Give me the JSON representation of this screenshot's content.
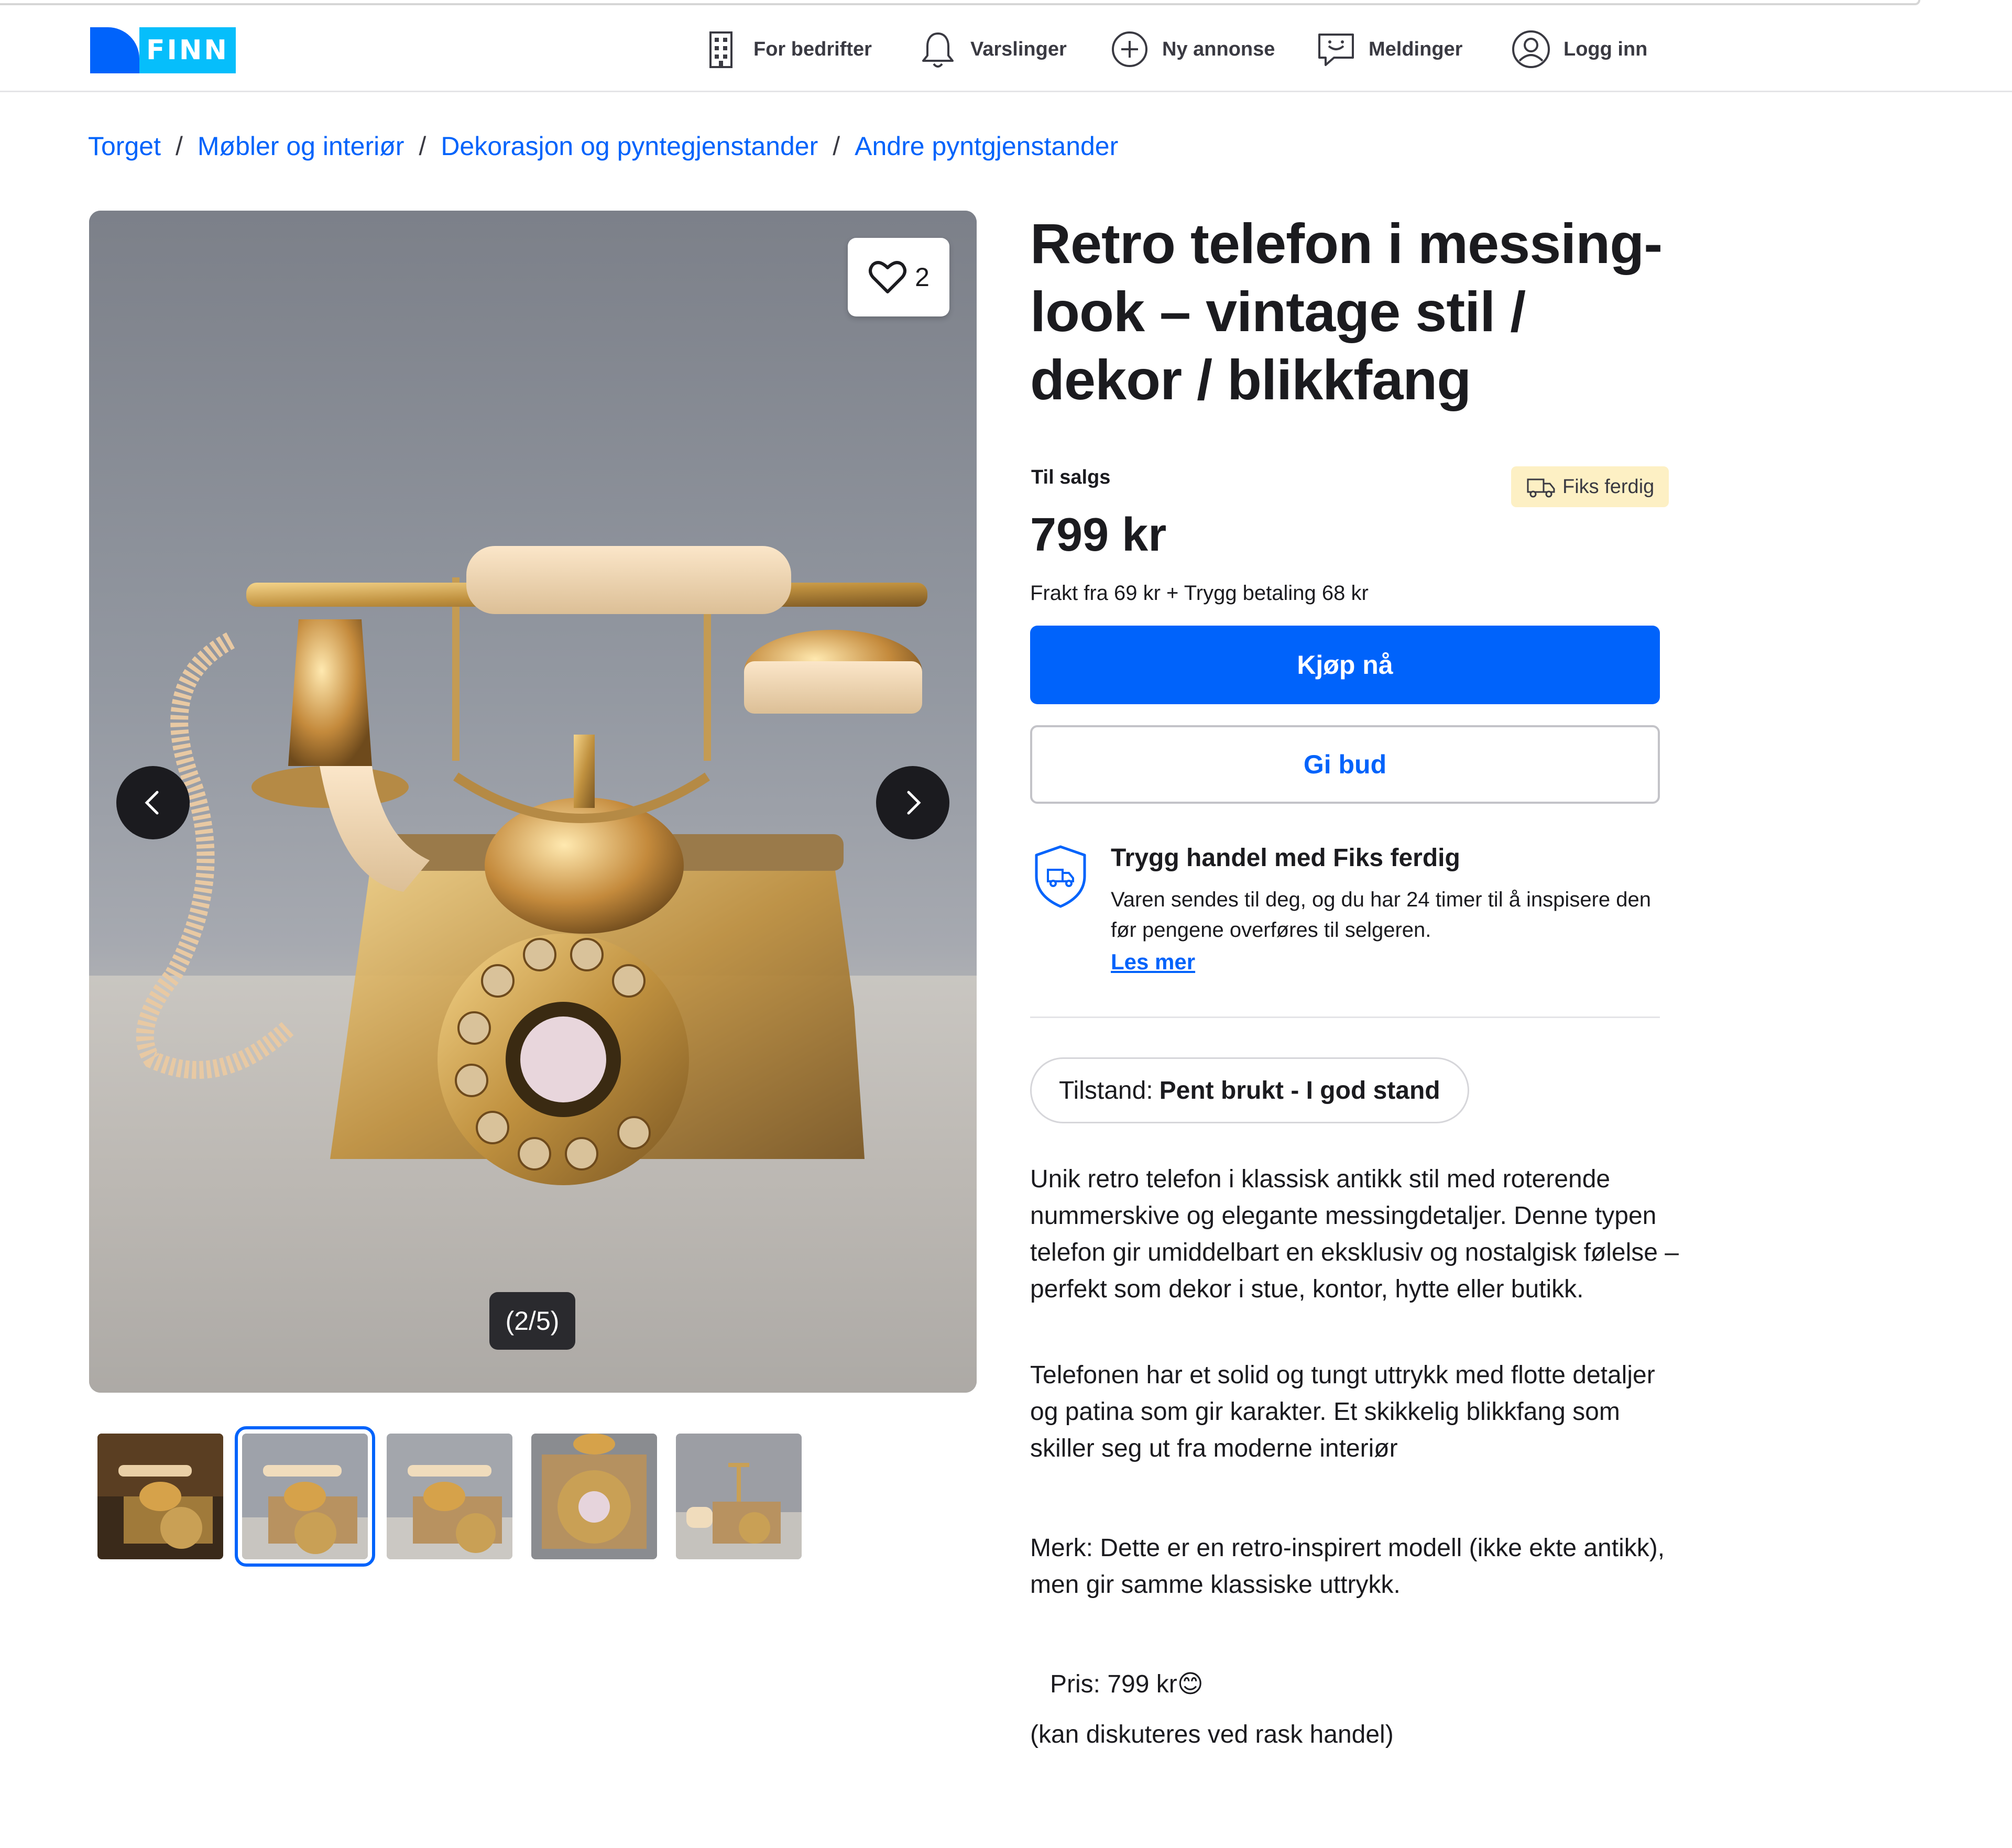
{
  "header": {
    "logo_text": "FINN",
    "nav": [
      {
        "label": "For bedrifter",
        "icon": "building-icon"
      },
      {
        "label": "Varslinger",
        "icon": "bell-icon"
      },
      {
        "label": "Ny annonse",
        "icon": "plus-circle-icon"
      },
      {
        "label": "Meldinger",
        "icon": "chat-icon"
      },
      {
        "label": "Logg inn",
        "icon": "user-circle-icon"
      }
    ]
  },
  "breadcrumb": [
    "Torget",
    "Møbler og interiør",
    "Dekorasjon og pyntegjenstander",
    "Andre pyntgjenstander"
  ],
  "gallery": {
    "favorites_count": "2",
    "counter": "(2/5)",
    "thumbnail_count": 5,
    "selected_thumbnail": 2
  },
  "listing": {
    "title": "Retro telefon i messing-look – vintage stil / dekor / blikkfang",
    "status": "Til salgs",
    "fiks_badge": "Fiks ferdig",
    "price": "799 kr",
    "shipping": "Frakt fra 69 kr + Trygg betaling 68 kr",
    "buy_label": "Kjøp nå",
    "bid_label": "Gi bud",
    "safe_title": "Trygg handel med Fiks ferdig",
    "safe_text": "Varen sendes til deg, og du har 24 timer til å inspisere den før pengene overføres til selgeren.",
    "safe_link": "Les mer",
    "condition_label": "Tilstand:",
    "condition_value": "Pent brukt - I god stand",
    "description": [
      "Unik retro telefon i klassisk antikk stil med roterende nummerskive og elegante messingdetaljer. Denne typen telefon gir umiddelbart en eksklusiv og nostalgisk følelse – perfekt som dekor i stue, kontor, hytte eller butikk.",
      "Telefonen har et solid og tungt uttrykk med flotte detaljer og patina som gir karakter. Et skikkelig blikkfang som skiller seg ut fra moderne interiør",
      "Merk: Dette er en retro-inspirert modell (ikke ekte antikk), men gir samme klassiske uttrykk.",
      "Pris: 799 kr😊",
      "(kan diskuteres ved rask handel)"
    ]
  },
  "colors": {
    "brand_blue": "#0063fb",
    "logo_cyan": "#06befb",
    "badge_yellow": "#fdf0c4"
  }
}
